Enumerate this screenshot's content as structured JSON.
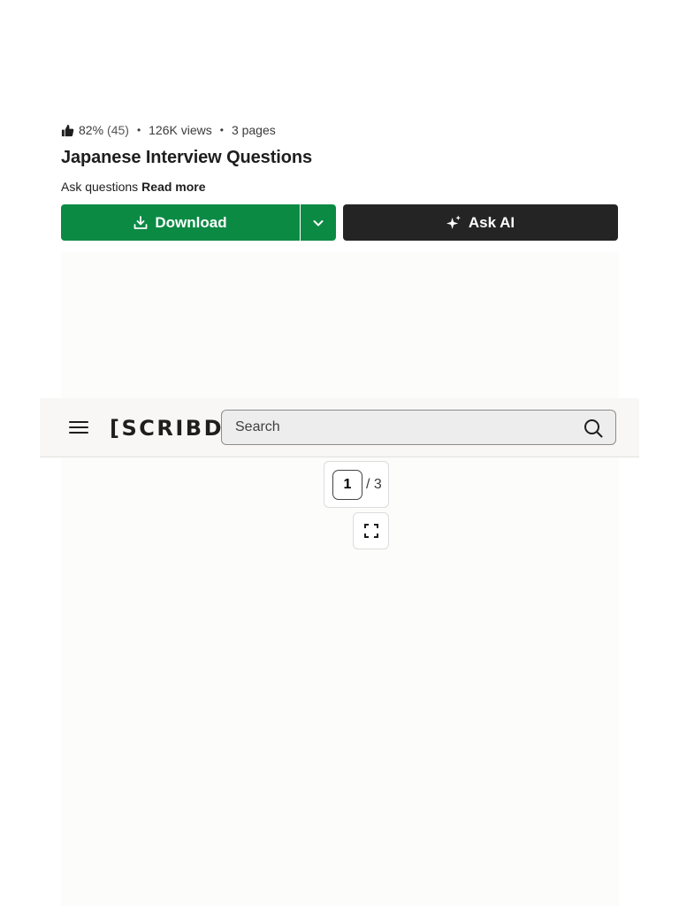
{
  "document": {
    "rating_percent": "82%",
    "rating_count": "(45)",
    "views": "126K views",
    "pages": "3 pages",
    "title": "Japanese Interview Questions",
    "description": "Ask questions",
    "read_more": "Read more"
  },
  "actions": {
    "download_label": "Download",
    "ask_ai_label": "Ask AI",
    "primary_color": "#0b8a44",
    "ai_color": "#242424"
  },
  "header": {
    "logo_text": "[SCRIBD]",
    "search_placeholder": "Search"
  },
  "pager": {
    "current_page": "1",
    "total": "/ 3"
  },
  "icons": {
    "rating": "thumbs-up-icon",
    "download": "download-icon",
    "caret": "chevron-down-icon",
    "ai": "sparkle-icon",
    "menu": "hamburger-menu-icon",
    "search": "search-icon",
    "fullscreen": "fullscreen-icon"
  }
}
